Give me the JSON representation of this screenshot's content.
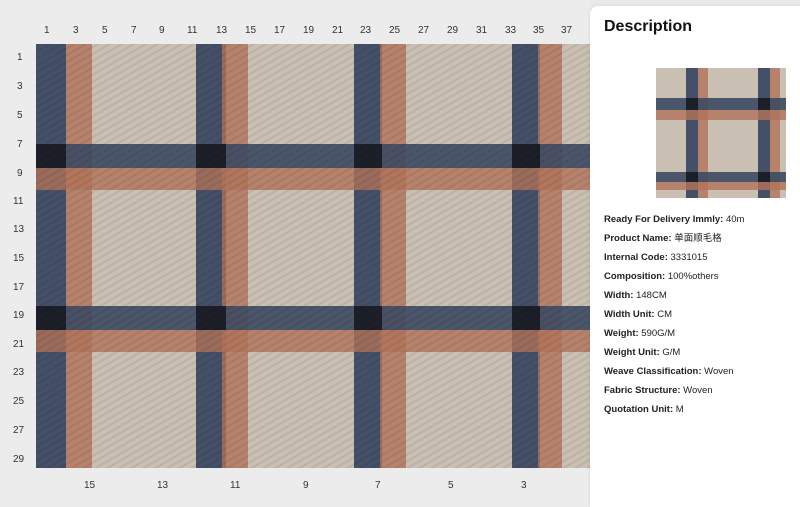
{
  "rulers": {
    "top": [
      "1",
      "3",
      "5",
      "7",
      "9",
      "11",
      "13",
      "15",
      "17",
      "19",
      "21",
      "23",
      "25",
      "27",
      "29",
      "31",
      "33",
      "35",
      "37"
    ],
    "left": [
      "1",
      "3",
      "5",
      "7",
      "9",
      "11",
      "13",
      "15",
      "17",
      "19",
      "21",
      "23",
      "25",
      "27",
      "29"
    ],
    "bottom": [
      "15",
      "13",
      "11",
      "9",
      "7",
      "5",
      "3"
    ]
  },
  "fabric": {
    "colors": {
      "base": "#c9bfb2",
      "navy": "#3d4a63",
      "rust": "#b2735a",
      "black": "#16181d"
    }
  },
  "panel": {
    "title": "Description",
    "properties": [
      {
        "key": "Ready For Delivery Immly:",
        "value": "40m"
      },
      {
        "key": "Product Name:",
        "value": "单面顺毛格"
      },
      {
        "key": "Internal Code:",
        "value": "3331015"
      },
      {
        "key": "Composition:",
        "value": "100%others"
      },
      {
        "key": "Width:",
        "value": "148CM"
      },
      {
        "key": "Width Unit:",
        "value": "CM"
      },
      {
        "key": "Weight:",
        "value": "590G/M"
      },
      {
        "key": "Weight Unit:",
        "value": "G/M"
      },
      {
        "key": "Weave Classification:",
        "value": "Woven"
      },
      {
        "key": "Fabric Structure:",
        "value": "Woven"
      },
      {
        "key": "Quotation Unit:",
        "value": "M"
      }
    ]
  }
}
